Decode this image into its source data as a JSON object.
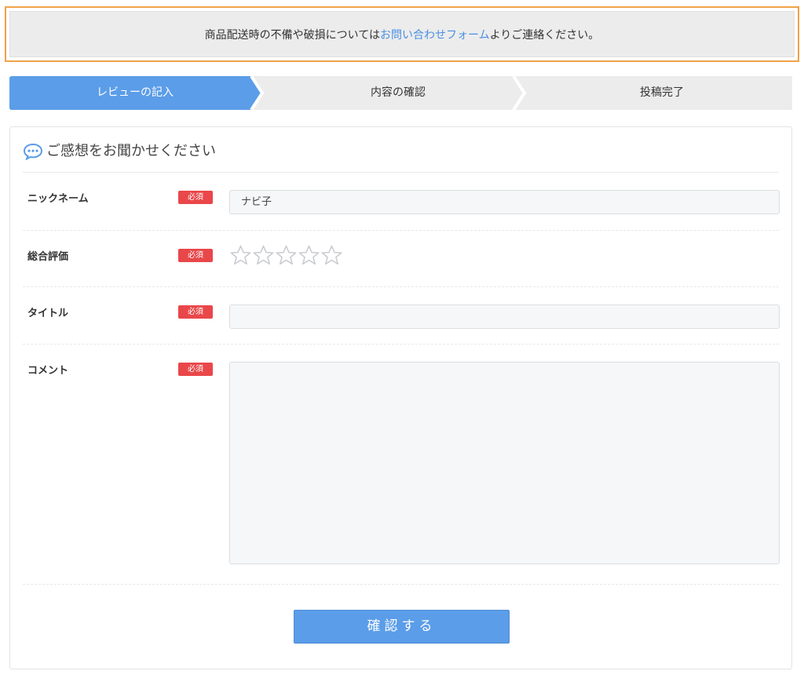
{
  "notice": {
    "text_before": "商品配送時の不備や破損については",
    "link_text": "お問い合わせフォーム",
    "text_after": "よりご連絡ください。"
  },
  "steps": [
    {
      "label": "レビューの記入",
      "active": true
    },
    {
      "label": "内容の確認",
      "active": false
    },
    {
      "label": "投稿完了",
      "active": false
    }
  ],
  "form": {
    "heading": "ご感想をお聞かせください",
    "required_badge": "必須",
    "fields": {
      "nickname": {
        "label": "ニックネーム",
        "value": "ナビ子"
      },
      "rating": {
        "label": "総合評価",
        "value": 0,
        "max": 5
      },
      "title": {
        "label": "タイトル",
        "value": ""
      },
      "comment": {
        "label": "コメント",
        "value": ""
      }
    },
    "submit_label": "確認する"
  },
  "colors": {
    "accent": "#5b9de8",
    "notice_border": "#f0a24a",
    "required": "#e9474a",
    "link": "#4a90e2"
  },
  "icons": {
    "heading": "chat-bubble-icon",
    "rating": "star-outline-icon"
  }
}
